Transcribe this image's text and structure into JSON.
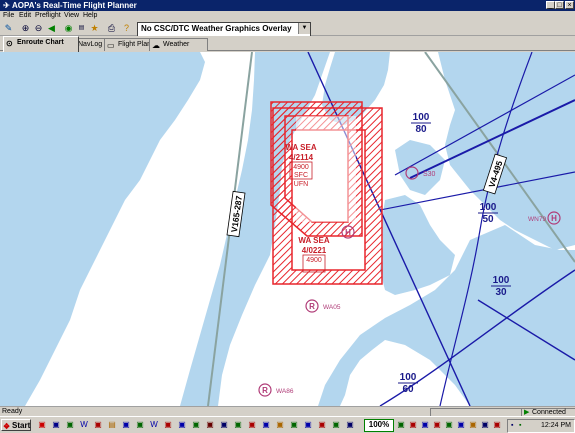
{
  "window": {
    "title": "AOPA's Real-Time Flight Planner",
    "buttons": {
      "minimize": "_",
      "maximize": "□",
      "close": "×"
    }
  },
  "menu": [
    "File",
    "Edit",
    "Preflight",
    "View",
    "Help"
  ],
  "toolbar": {
    "weather_overlay": "No CSC/DTC Weather Graphics Overlay",
    "icons": [
      "pointer-icon",
      "zoom-in-icon",
      "zoom-out-icon",
      "back-icon",
      "route-icon",
      "lon-icon",
      "print-icon",
      "help-icon"
    ]
  },
  "tabs": [
    {
      "label": "Enroute Chart",
      "active": true
    },
    {
      "label": "NavLog",
      "active": false
    },
    {
      "label": "Flight Plan",
      "active": false
    },
    {
      "label": "Weather",
      "active": false
    }
  ],
  "map": {
    "airways": [
      "V165-287",
      "V4-495"
    ],
    "restricted_areas": [
      {
        "name": "WA SEA",
        "number": "4/2114",
        "ceiling": "4900",
        "floor": "SFC",
        "note": "UFN"
      },
      {
        "name": "WA SEA",
        "number": "4/0221",
        "ceiling": "4900",
        "floor": ""
      }
    ],
    "altitude_blocks": [
      {
        "top": "100",
        "bottom": "80"
      },
      {
        "top": "100",
        "bottom": "50"
      },
      {
        "top": "100",
        "bottom": "30"
      },
      {
        "top": "100",
        "bottom": "60"
      }
    ],
    "airports": [
      {
        "symbol": "H",
        "id": "S30"
      },
      {
        "symbol": "H",
        "id": "WN79"
      },
      {
        "symbol": "H",
        "id": ""
      },
      {
        "symbol": "R",
        "id": "WA05"
      },
      {
        "symbol": "R",
        "id": "WA86"
      }
    ],
    "colors": {
      "water": "#b3d6ee",
      "land": "#ffffff",
      "restricted": "#e8262d",
      "airway": "#1a1aa8",
      "airport": "#b03c78"
    }
  },
  "status": {
    "text": "Ready",
    "connection": "Connected"
  },
  "taskbar": {
    "start": "Start",
    "zoom": "100%",
    "clock": "12:24 PM"
  }
}
